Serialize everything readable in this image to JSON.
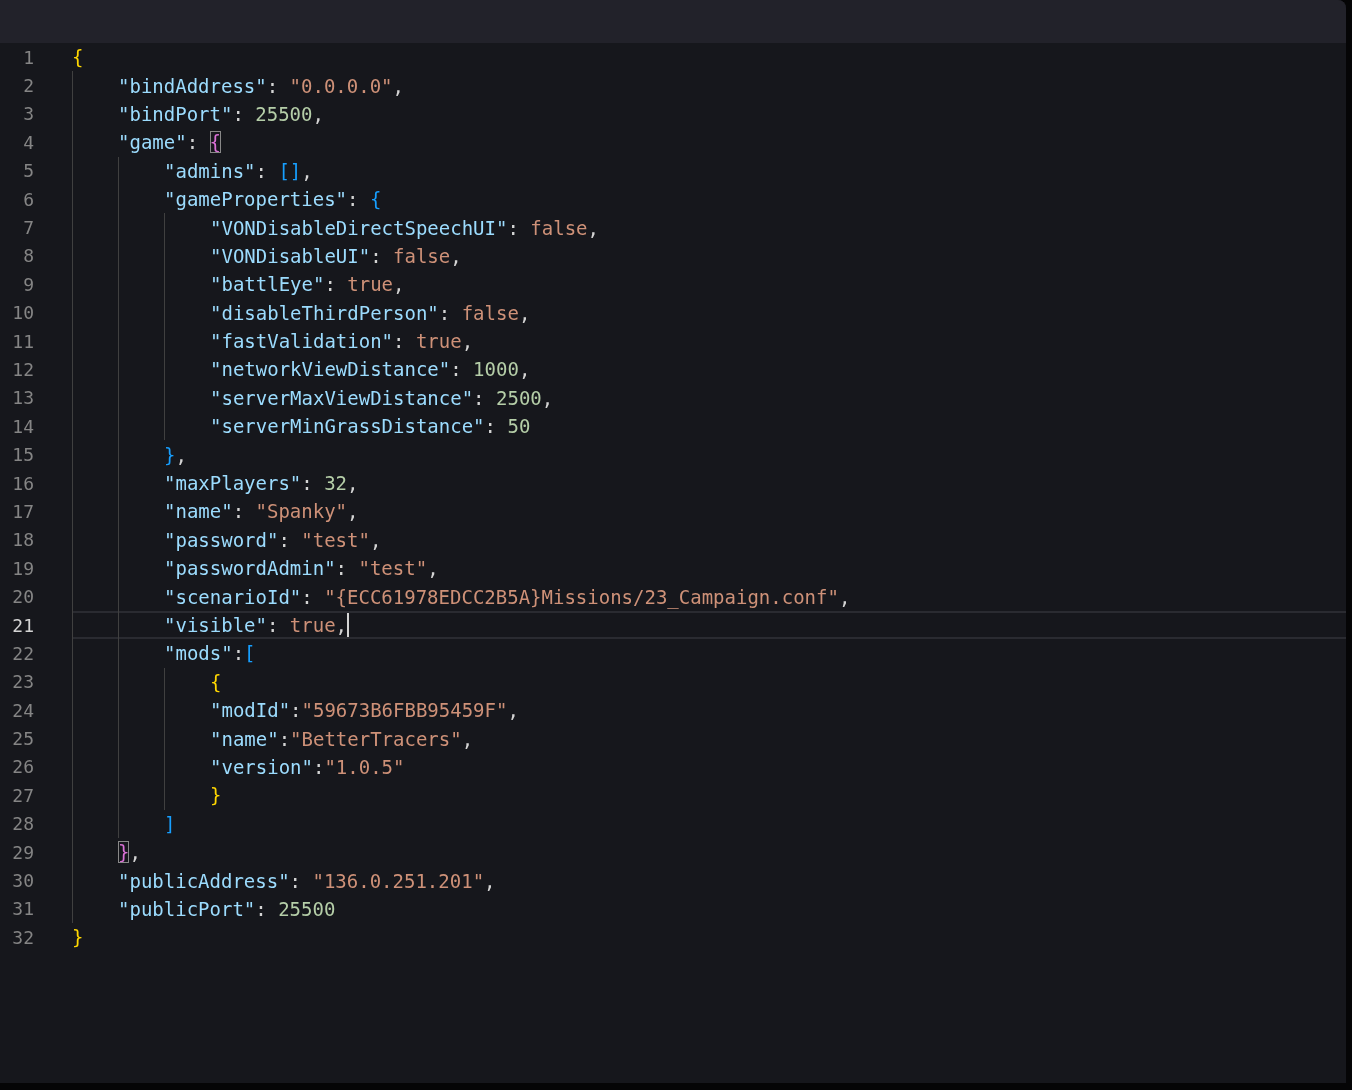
{
  "editor": {
    "lines": [
      {
        "number": "1",
        "active": false,
        "cursor": false,
        "tokens": [
          {
            "kind": "bracket",
            "text": "{",
            "color": "#ffd700",
            "matched": false
          }
        ],
        "children": [
          {
            "number": "2",
            "active": false,
            "cursor": false,
            "tokens": [
              {
                "kind": "key",
                "text": "\"bindAddress\""
              },
              {
                "kind": "punct",
                "text": ": "
              },
              {
                "kind": "string",
                "text": "\"0.0.0.0\""
              },
              {
                "kind": "punct",
                "text": ","
              }
            ]
          },
          {
            "number": "3",
            "active": false,
            "cursor": false,
            "tokens": [
              {
                "kind": "key",
                "text": "\"bindPort\""
              },
              {
                "kind": "punct",
                "text": ": "
              },
              {
                "kind": "number",
                "text": "25500"
              },
              {
                "kind": "punct",
                "text": ","
              }
            ]
          },
          {
            "number": "4",
            "active": false,
            "cursor": false,
            "tokens": [
              {
                "kind": "key",
                "text": "\"game\""
              },
              {
                "kind": "punct",
                "text": ": "
              },
              {
                "kind": "bracket",
                "text": "{",
                "color": "#da70d6",
                "matched": true
              }
            ],
            "children": [
              {
                "number": "5",
                "active": false,
                "cursor": false,
                "tokens": [
                  {
                    "kind": "key",
                    "text": "\"admins\""
                  },
                  {
                    "kind": "punct",
                    "text": ": "
                  },
                  {
                    "kind": "bracket",
                    "text": "[]",
                    "color": "#179fff",
                    "matched": false
                  },
                  {
                    "kind": "punct",
                    "text": ","
                  }
                ]
              },
              {
                "number": "6",
                "active": false,
                "cursor": false,
                "tokens": [
                  {
                    "kind": "key",
                    "text": "\"gameProperties\""
                  },
                  {
                    "kind": "punct",
                    "text": ": "
                  },
                  {
                    "kind": "bracket",
                    "text": "{",
                    "color": "#179fff",
                    "matched": false
                  }
                ],
                "children": [
                  {
                    "number": "7",
                    "active": false,
                    "cursor": false,
                    "tokens": [
                      {
                        "kind": "key",
                        "text": "\"VONDisableDirectSpeechUI\""
                      },
                      {
                        "kind": "punct",
                        "text": ": "
                      },
                      {
                        "kind": "boolean",
                        "text": "false"
                      },
                      {
                        "kind": "punct",
                        "text": ","
                      }
                    ]
                  },
                  {
                    "number": "8",
                    "active": false,
                    "cursor": false,
                    "tokens": [
                      {
                        "kind": "key",
                        "text": "\"VONDisableUI\""
                      },
                      {
                        "kind": "punct",
                        "text": ": "
                      },
                      {
                        "kind": "boolean",
                        "text": "false"
                      },
                      {
                        "kind": "punct",
                        "text": ","
                      }
                    ]
                  },
                  {
                    "number": "9",
                    "active": false,
                    "cursor": false,
                    "tokens": [
                      {
                        "kind": "key",
                        "text": "\"battlEye\""
                      },
                      {
                        "kind": "punct",
                        "text": ": "
                      },
                      {
                        "kind": "boolean",
                        "text": "true"
                      },
                      {
                        "kind": "punct",
                        "text": ","
                      }
                    ]
                  },
                  {
                    "number": "10",
                    "active": false,
                    "cursor": false,
                    "tokens": [
                      {
                        "kind": "key",
                        "text": "\"disableThirdPerson\""
                      },
                      {
                        "kind": "punct",
                        "text": ": "
                      },
                      {
                        "kind": "boolean",
                        "text": "false"
                      },
                      {
                        "kind": "punct",
                        "text": ","
                      }
                    ]
                  },
                  {
                    "number": "11",
                    "active": false,
                    "cursor": false,
                    "tokens": [
                      {
                        "kind": "key",
                        "text": "\"fastValidation\""
                      },
                      {
                        "kind": "punct",
                        "text": ": "
                      },
                      {
                        "kind": "boolean",
                        "text": "true"
                      },
                      {
                        "kind": "punct",
                        "text": ","
                      }
                    ]
                  },
                  {
                    "number": "12",
                    "active": false,
                    "cursor": false,
                    "tokens": [
                      {
                        "kind": "key",
                        "text": "\"networkViewDistance\""
                      },
                      {
                        "kind": "punct",
                        "text": ": "
                      },
                      {
                        "kind": "number",
                        "text": "1000"
                      },
                      {
                        "kind": "punct",
                        "text": ","
                      }
                    ]
                  },
                  {
                    "number": "13",
                    "active": false,
                    "cursor": false,
                    "tokens": [
                      {
                        "kind": "key",
                        "text": "\"serverMaxViewDistance\""
                      },
                      {
                        "kind": "punct",
                        "text": ": "
                      },
                      {
                        "kind": "number",
                        "text": "2500"
                      },
                      {
                        "kind": "punct",
                        "text": ","
                      }
                    ]
                  },
                  {
                    "number": "14",
                    "active": false,
                    "cursor": false,
                    "tokens": [
                      {
                        "kind": "key",
                        "text": "\"serverMinGrassDistance\""
                      },
                      {
                        "kind": "punct",
                        "text": ": "
                      },
                      {
                        "kind": "number",
                        "text": "50"
                      }
                    ]
                  }
                ]
              },
              {
                "number": "15",
                "active": false,
                "cursor": false,
                "tokens": [
                  {
                    "kind": "bracket",
                    "text": "}",
                    "color": "#179fff",
                    "matched": false
                  },
                  {
                    "kind": "punct",
                    "text": ","
                  }
                ]
              },
              {
                "number": "16",
                "active": false,
                "cursor": false,
                "tokens": [
                  {
                    "kind": "key",
                    "text": "\"maxPlayers\""
                  },
                  {
                    "kind": "punct",
                    "text": ": "
                  },
                  {
                    "kind": "number",
                    "text": "32"
                  },
                  {
                    "kind": "punct",
                    "text": ","
                  }
                ]
              },
              {
                "number": "17",
                "active": false,
                "cursor": false,
                "tokens": [
                  {
                    "kind": "key",
                    "text": "\"name\""
                  },
                  {
                    "kind": "punct",
                    "text": ": "
                  },
                  {
                    "kind": "string",
                    "text": "\"Spanky\""
                  },
                  {
                    "kind": "punct",
                    "text": ","
                  }
                ]
              },
              {
                "number": "18",
                "active": false,
                "cursor": false,
                "tokens": [
                  {
                    "kind": "key",
                    "text": "\"password\""
                  },
                  {
                    "kind": "punct",
                    "text": ": "
                  },
                  {
                    "kind": "string",
                    "text": "\"test\""
                  },
                  {
                    "kind": "punct",
                    "text": ","
                  }
                ]
              },
              {
                "number": "19",
                "active": false,
                "cursor": false,
                "tokens": [
                  {
                    "kind": "key",
                    "text": "\"passwordAdmin\""
                  },
                  {
                    "kind": "punct",
                    "text": ": "
                  },
                  {
                    "kind": "string",
                    "text": "\"test\""
                  },
                  {
                    "kind": "punct",
                    "text": ","
                  }
                ]
              },
              {
                "number": "20",
                "active": false,
                "cursor": false,
                "tokens": [
                  {
                    "kind": "key",
                    "text": "\"scenarioId\""
                  },
                  {
                    "kind": "punct",
                    "text": ": "
                  },
                  {
                    "kind": "string",
                    "text": "\"{ECC61978EDCC2B5A}Missions/23_Campaign.conf\""
                  },
                  {
                    "kind": "punct",
                    "text": ","
                  }
                ]
              },
              {
                "number": "21",
                "active": true,
                "cursor": true,
                "tokens": [
                  {
                    "kind": "key",
                    "text": "\"visible\""
                  },
                  {
                    "kind": "punct",
                    "text": ": "
                  },
                  {
                    "kind": "boolean",
                    "text": "true"
                  },
                  {
                    "kind": "punct",
                    "text": ","
                  }
                ]
              },
              {
                "number": "22",
                "active": false,
                "cursor": false,
                "tokens": [
                  {
                    "kind": "key",
                    "text": "\"mods\""
                  },
                  {
                    "kind": "punct",
                    "text": ":"
                  },
                  {
                    "kind": "bracket",
                    "text": "[",
                    "color": "#179fff",
                    "matched": false
                  }
                ],
                "children": [
                  {
                    "number": "23",
                    "active": false,
                    "cursor": false,
                    "tokens": [
                      {
                        "kind": "bracket",
                        "text": "{",
                        "color": "#ffd700",
                        "matched": false
                      }
                    ]
                  },
                  {
                    "number": "24",
                    "active": false,
                    "cursor": false,
                    "tokens": [
                      {
                        "kind": "key",
                        "text": "\"modId\""
                      },
                      {
                        "kind": "punct",
                        "text": ":"
                      },
                      {
                        "kind": "string",
                        "text": "\"59673B6FBB95459F\""
                      },
                      {
                        "kind": "punct",
                        "text": ","
                      }
                    ]
                  },
                  {
                    "number": "25",
                    "active": false,
                    "cursor": false,
                    "tokens": [
                      {
                        "kind": "key",
                        "text": "\"name\""
                      },
                      {
                        "kind": "punct",
                        "text": ":"
                      },
                      {
                        "kind": "string",
                        "text": "\"BetterTracers\""
                      },
                      {
                        "kind": "punct",
                        "text": ","
                      }
                    ]
                  },
                  {
                    "number": "26",
                    "active": false,
                    "cursor": false,
                    "tokens": [
                      {
                        "kind": "key",
                        "text": "\"version\""
                      },
                      {
                        "kind": "punct",
                        "text": ":"
                      },
                      {
                        "kind": "string",
                        "text": "\"1.0.5\""
                      }
                    ]
                  },
                  {
                    "number": "27",
                    "active": false,
                    "cursor": false,
                    "tokens": [
                      {
                        "kind": "bracket",
                        "text": "}",
                        "color": "#ffd700",
                        "matched": false
                      }
                    ]
                  }
                ]
              },
              {
                "number": "28",
                "active": false,
                "cursor": false,
                "tokens": [
                  {
                    "kind": "bracket",
                    "text": "]",
                    "color": "#179fff",
                    "matched": false
                  }
                ]
              }
            ]
          },
          {
            "number": "29",
            "active": false,
            "cursor": false,
            "tokens": [
              {
                "kind": "bracket",
                "text": "}",
                "color": "#da70d6",
                "matched": true
              },
              {
                "kind": "punct",
                "text": ","
              }
            ]
          },
          {
            "number": "30",
            "active": false,
            "cursor": false,
            "tokens": [
              {
                "kind": "key",
                "text": "\"publicAddress\""
              },
              {
                "kind": "punct",
                "text": ": "
              },
              {
                "kind": "string",
                "text": "\"136.0.251.201\""
              },
              {
                "kind": "punct",
                "text": ","
              }
            ]
          },
          {
            "number": "31",
            "active": false,
            "cursor": false,
            "tokens": [
              {
                "kind": "key",
                "text": "\"publicPort\""
              },
              {
                "kind": "punct",
                "text": ": "
              },
              {
                "kind": "number",
                "text": "25500"
              }
            ]
          }
        ]
      },
      {
        "number": "32",
        "active": false,
        "cursor": false,
        "tokens": [
          {
            "kind": "bracket",
            "text": "}",
            "color": "#ffd700",
            "matched": false
          }
        ]
      }
    ]
  }
}
